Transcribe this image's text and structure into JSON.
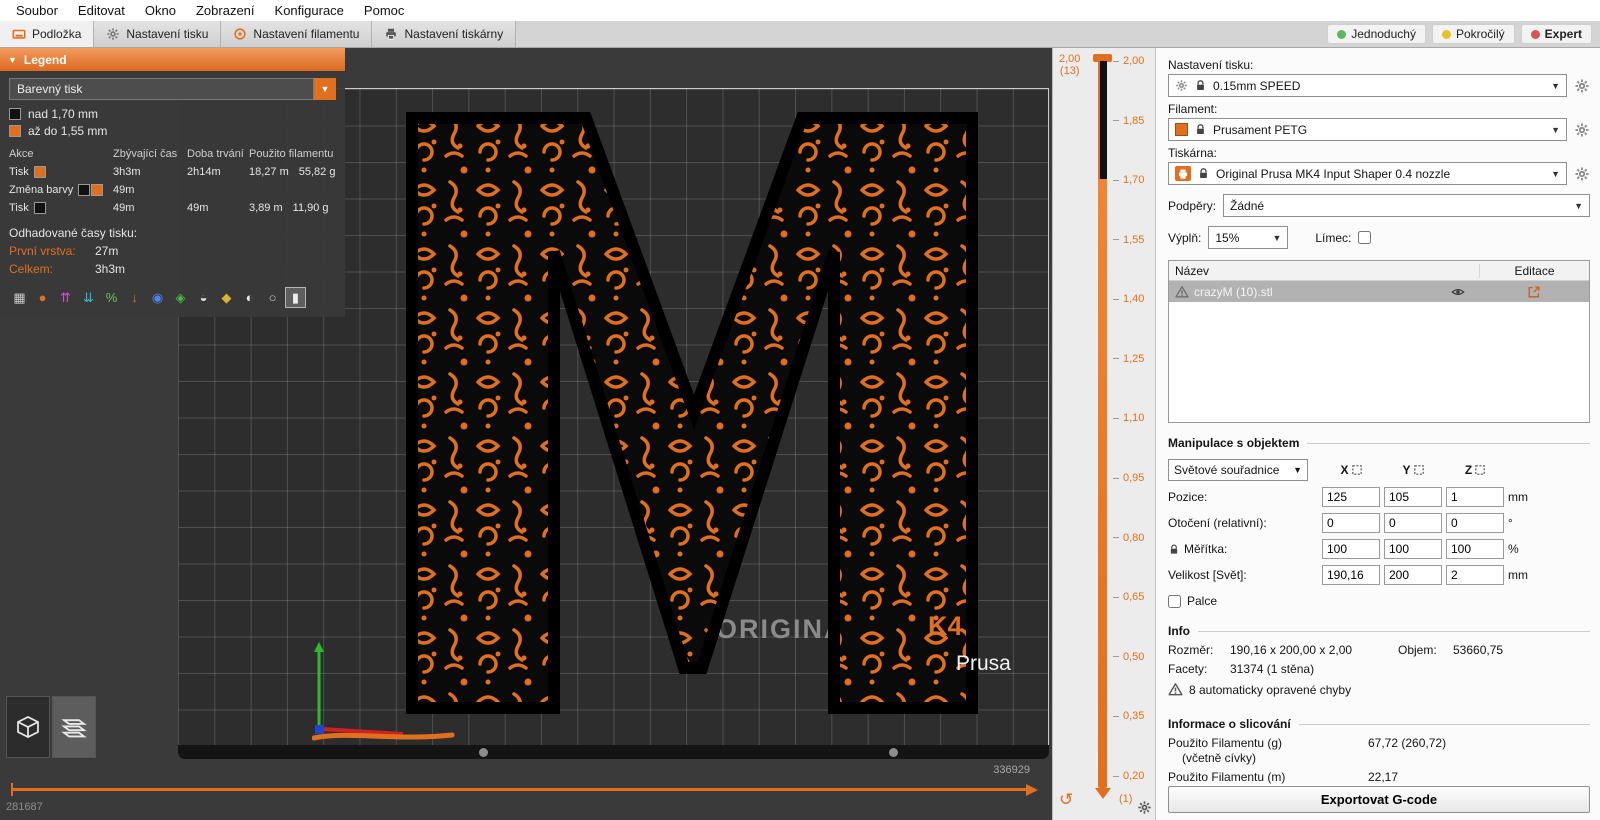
{
  "menu": {
    "items": [
      "Soubor",
      "Editovat",
      "Okno",
      "Zobrazení",
      "Konfigurace",
      "Pomoc"
    ]
  },
  "tabs": {
    "items": [
      {
        "label": "Podložka"
      },
      {
        "label": "Nastavení tisku"
      },
      {
        "label": "Nastavení filamentu"
      },
      {
        "label": "Nastavení tiskárny"
      }
    ],
    "modes": [
      {
        "label": "Jednoduchý",
        "color": "#5cb85c"
      },
      {
        "label": "Pokročilý",
        "color": "#e6c229"
      },
      {
        "label": "Expert",
        "color": "#d9534f"
      }
    ]
  },
  "icons": {
    "dropdown_arrow": "▼",
    "legend_collapse": "▼",
    "undo": "↺"
  },
  "legend": {
    "title": "Legend",
    "view_select": "Barevný tisk",
    "items": [
      {
        "label": "nad 1,70 mm",
        "color": "#111111"
      },
      {
        "label": "až do 1,55 mm",
        "color": "#e0701f"
      }
    ],
    "table": {
      "headers": [
        "Akce",
        "Zbývající čas",
        "Doba trvání",
        "Použito filamentu"
      ],
      "rows": [
        {
          "action": "Tisk",
          "remaining": "3h3m",
          "duration": "2h14m",
          "used_m": "18,27 m",
          "used_g": "55,82 g"
        },
        {
          "action": "Změna barvy",
          "remaining": "49m",
          "duration": "",
          "used_m": "",
          "used_g": ""
        },
        {
          "action": "Tisk",
          "remaining": "49m",
          "duration": "49m",
          "used_m": "3,89 m",
          "used_g": "11,90 g"
        }
      ]
    },
    "estimates_title": "Odhadované časy tisku:",
    "estimates": [
      {
        "label": "První vrstva:",
        "value": "27m"
      },
      {
        "label": "Celkem:",
        "value": "3h3m"
      }
    ],
    "toolbar_icons": [
      {
        "name": "feature-type-icon",
        "glyph": "▦"
      },
      {
        "name": "filament-icon",
        "glyph": "●"
      },
      {
        "name": "height-icon",
        "glyph": "⇈"
      },
      {
        "name": "width-icon",
        "glyph": "⇊"
      },
      {
        "name": "speed-icon",
        "glyph": "%"
      },
      {
        "name": "fan-speed-icon",
        "glyph": "↓"
      },
      {
        "name": "temperature-icon",
        "glyph": "◉"
      },
      {
        "name": "flow-icon",
        "glyph": "◈"
      },
      {
        "name": "time-icon",
        "glyph": "◒"
      },
      {
        "name": "tool-icon",
        "glyph": "◆"
      },
      {
        "name": "shells-icon",
        "glyph": "◐"
      },
      {
        "name": "sphere-icon",
        "glyph": "○"
      },
      {
        "name": "color-print-icon",
        "glyph": "▮"
      }
    ]
  },
  "viewport": {
    "brand": {
      "original": "ORIGINAL",
      "k4": "K4",
      "prusa": "Prusa"
    },
    "bottom_counter": "336929",
    "bottom_left_counter": "281687"
  },
  "layer_slider": {
    "top_value": "2,00",
    "top_layer": "(13)",
    "ticks": [
      "2,00",
      "1,85",
      "1,70",
      "1,55",
      "1,40",
      "1,25",
      "1,10",
      "0,95",
      "0,80",
      "0,65",
      "0,50",
      "0,35",
      "0,20"
    ],
    "bottom_layer": "(1)"
  },
  "sidebar": {
    "print_settings": {
      "label": "Nastavení tisku:",
      "value": "0.15mm SPEED"
    },
    "filament": {
      "label": "Filament:",
      "value": "Prusament PETG"
    },
    "printer": {
      "label": "Tiskárna:",
      "value": "Original Prusa MK4 Input Shaper 0.4 nozzle"
    },
    "supports": {
      "label": "Podpěry:",
      "value": "Žádné"
    },
    "infill": {
      "label": "Výplň:",
      "value": "15%"
    },
    "brim": {
      "label": "Límec:"
    },
    "objects": {
      "col_name": "Název",
      "col_edit": "Editace",
      "rows": [
        {
          "name": "crazyM (10).stl"
        }
      ]
    },
    "manipulation": {
      "title": "Manipulace s objektem",
      "coord_system": "Světové souřadnice",
      "axes": [
        "X",
        "Y",
        "Z"
      ],
      "rows": [
        {
          "label": "Pozice:",
          "x": "125",
          "y": "105",
          "z": "1",
          "unit": "mm"
        },
        {
          "label": "Otočení (relativní):",
          "x": "0",
          "y": "0",
          "z": "0",
          "unit": "°"
        },
        {
          "label": "Měřítka:",
          "x": "100",
          "y": "100",
          "z": "100",
          "unit": "%"
        },
        {
          "label": "Velikost [Svět]:",
          "x": "190,16",
          "y": "200",
          "z": "2",
          "unit": "mm"
        }
      ],
      "inches_label": "Palce"
    },
    "info": {
      "title": "Info",
      "size_label": "Rozměr:",
      "size_value": "190,16 x 200,00 x 2,00",
      "volume_label": "Objem:",
      "volume_value": "53660,75",
      "facets_label": "Facety:",
      "facets_value": "31374 (1 stěna)",
      "warning": "8 automaticky opravené chyby"
    },
    "slicing": {
      "title": "Informace o slicování",
      "row1_label": "Použito Filamentu (g)",
      "row1_sub": "(včetně cívky)",
      "row1_value": "67,72 (260,72)",
      "row2_label": "Použito Filamentu (m)",
      "row2_value": "22,17"
    },
    "export_button": "Exportovat G-code"
  }
}
